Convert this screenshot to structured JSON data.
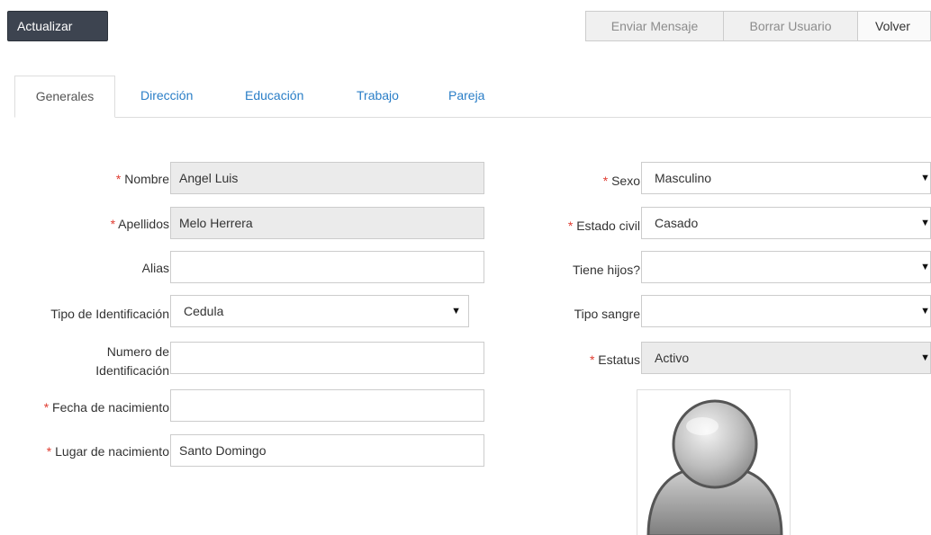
{
  "toolbar": {
    "update_label": "Actualizar",
    "send_message_label": "Enviar Mensaje",
    "delete_user_label": "Borrar Usuario",
    "back_label": "Volver"
  },
  "tabs": [
    {
      "label": "Generales"
    },
    {
      "label": "Dirección"
    },
    {
      "label": "Educación"
    },
    {
      "label": "Trabajo"
    },
    {
      "label": "Pareja"
    }
  ],
  "required_marker": "*",
  "left_form": {
    "nombre": {
      "label": "Nombre",
      "value": "Angel Luis"
    },
    "apellidos": {
      "label": "Apellidos",
      "value": "Melo Herrera"
    },
    "alias": {
      "label": "Alias",
      "value": ""
    },
    "tipo_id": {
      "label": "Tipo de Identificación",
      "value": "Cedula"
    },
    "numero_id": {
      "label_line1": "Numero de",
      "label_line2": "Identificación",
      "value": ""
    },
    "fecha_nac": {
      "label": "Fecha de nacimiento",
      "value": ""
    },
    "lugar_nac": {
      "label": "Lugar de nacimiento",
      "value": "Santo Domingo"
    }
  },
  "right_form": {
    "sexo": {
      "label": "Sexo",
      "value": "Masculino"
    },
    "estado_civil": {
      "label": "Estado civil",
      "value": "Casado"
    },
    "tiene_hijos": {
      "label": "Tiene hijos?",
      "value": ""
    },
    "tipo_sangre": {
      "label": "Tipo sangre",
      "value": ""
    },
    "estatus": {
      "label": "Estatus",
      "value": "Activo"
    }
  },
  "select_arrow": "▼",
  "avatar_icon": "user-silhouette-icon"
}
